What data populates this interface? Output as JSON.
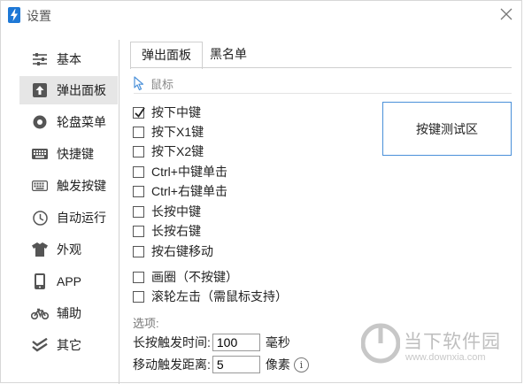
{
  "window": {
    "title": "设置",
    "accent": "#1e78d6"
  },
  "sidebar": {
    "items": [
      {
        "label": "基本",
        "icon": "sliders-icon"
      },
      {
        "label": "弹出面板",
        "icon": "upload-box-icon",
        "active": true
      },
      {
        "label": "轮盘菜单",
        "icon": "wheel-icon"
      },
      {
        "label": "快捷键",
        "icon": "keyboard-icon"
      },
      {
        "label": "触发按键",
        "icon": "keyboard-outline-icon"
      },
      {
        "label": "自动运行",
        "icon": "clock-icon"
      },
      {
        "label": "外观",
        "icon": "tshirt-icon"
      },
      {
        "label": "APP",
        "icon": "phone-icon"
      },
      {
        "label": "辅助",
        "icon": "bicycle-icon"
      },
      {
        "label": "其它",
        "icon": "double-check-icon"
      }
    ]
  },
  "tabs": [
    {
      "label": "弹出面板",
      "active": true
    },
    {
      "label": "黑名单",
      "active": false
    }
  ],
  "section": {
    "title": "鼠标"
  },
  "checkboxes": [
    {
      "label": "按下中键",
      "checked": true
    },
    {
      "label": "按下X1键",
      "checked": false
    },
    {
      "label": "按下X2键",
      "checked": false
    },
    {
      "label": "Ctrl+中键单击",
      "checked": false
    },
    {
      "label": "Ctrl+右键单击",
      "checked": false
    },
    {
      "label": "长按中键",
      "checked": false
    },
    {
      "label": "长按右键",
      "checked": false
    },
    {
      "label": "按右键移动",
      "checked": false
    },
    {
      "label": "画圈（不按键）",
      "checked": false
    },
    {
      "label": "滚轮左击（需鼠标支持）",
      "checked": false
    }
  ],
  "test_area": {
    "label": "按键测试区"
  },
  "options": {
    "label": "选项:",
    "long_press": {
      "label": "长按触发时间:",
      "value": "100",
      "unit": "毫秒"
    },
    "move_distance": {
      "label": "移动触发距离:",
      "value": "5",
      "unit": "像素"
    }
  },
  "watermark": {
    "text": "当下软件园",
    "url": "www.downxia.com"
  }
}
